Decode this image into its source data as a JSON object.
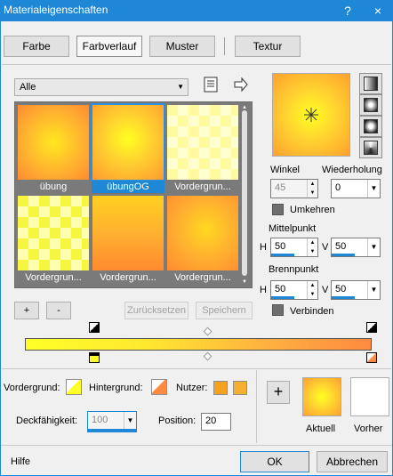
{
  "window": {
    "title": "Materialeigenschaften",
    "help_icon": "?",
    "close_icon": "×"
  },
  "tabs": [
    {
      "label": "Farbe"
    },
    {
      "label": "Farbverlauf"
    },
    {
      "label": "Muster"
    },
    {
      "label": "Textur"
    }
  ],
  "gallery": {
    "category": "Alle",
    "items": [
      {
        "label": "übung"
      },
      {
        "label": "übungOG"
      },
      {
        "label": "Vordergrun..."
      },
      {
        "label": "Vordergrun..."
      },
      {
        "label": "Vordergrun..."
      },
      {
        "label": "Vordergrun..."
      }
    ],
    "add_label": "+",
    "remove_label": "-",
    "reset_label": "Zurücksetzen",
    "save_label": "Speichern"
  },
  "params": {
    "angle_label": "Winkel",
    "angle_value": "45",
    "repeat_label": "Wiederholung",
    "repeat_value": "0",
    "invert_label": "Umkehren",
    "center_label": "Mittelpunkt",
    "center_h": "50",
    "center_v": "50",
    "focus_label": "Brennpunkt",
    "focus_h": "50",
    "focus_v": "50",
    "h_label": "H",
    "v_label": "V",
    "link_label": "Verbinden"
  },
  "bottom_panel": {
    "fg_label": "Vordergrund:",
    "bg_label": "Hintergrund:",
    "user_label": "Nutzer:",
    "opacity_label": "Deckfähigkeit:",
    "opacity_value": "100",
    "position_label": "Position:",
    "position_value": "20",
    "plus_label": "+",
    "current_label": "Aktuell",
    "previous_label": "Vorher"
  },
  "footer": {
    "help_label": "Hilfe",
    "ok_label": "OK",
    "cancel_label": "Abbrechen"
  },
  "colors": {
    "accent": "#1e87d6",
    "gradient_start": "#ffff28",
    "gradient_end": "#ff8a40"
  }
}
